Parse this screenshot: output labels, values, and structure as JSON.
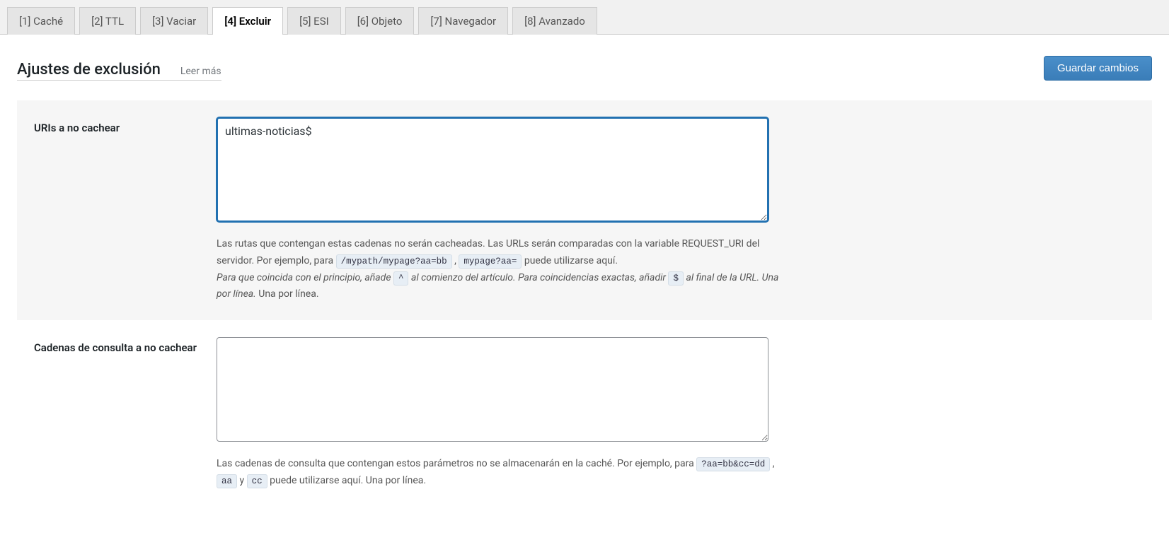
{
  "tabs": [
    {
      "label": "[1] Caché"
    },
    {
      "label": "[2] TTL"
    },
    {
      "label": "[3] Vaciar"
    },
    {
      "label": "[4] Excluir",
      "active": true
    },
    {
      "label": "[5] ESI"
    },
    {
      "label": "[6] Objeto"
    },
    {
      "label": "[7] Navegador"
    },
    {
      "label": "[8] Avanzado"
    }
  ],
  "header": {
    "title": "Ajustes de exclusión",
    "read_more": "Leer más",
    "save_button": "Guardar cambios"
  },
  "fields": {
    "uris": {
      "label": "URIs a no cachear",
      "value": "ultimas-noticias$",
      "desc_intro": "Las rutas que contengan estas cadenas no serán cacheadas. Las URLs serán comparadas con la variable REQUEST_URI del servidor. Por ejemplo, para ",
      "code1": "/mypath/mypage?aa=bb",
      "sep1": " , ",
      "code2": "mypage?aa=",
      "desc_after_codes": " puede utilizarse aquí.",
      "line2_pre": "Para que coincida con el principio, añade ",
      "code_caret": "^",
      "line2_mid": " al comienzo del artículo. Para coincidencias exactas, añadir ",
      "code_dollar": "$",
      "line2_post": " al final de la URL. Una por línea.",
      "line2_tail": " Una por línea."
    },
    "query": {
      "label": "Cadenas de consulta a no cachear",
      "value": "",
      "desc_pre": "Las cadenas de consulta que contengan estos parámetros no se almacenarán en la caché. Por ejemplo, para ",
      "code1": "?aa=bb&cc=dd",
      "sep1": " , ",
      "code2": "aa",
      "sep2": " y ",
      "code3": "cc",
      "desc_post": " puede utilizarse aquí. Una por línea."
    }
  }
}
